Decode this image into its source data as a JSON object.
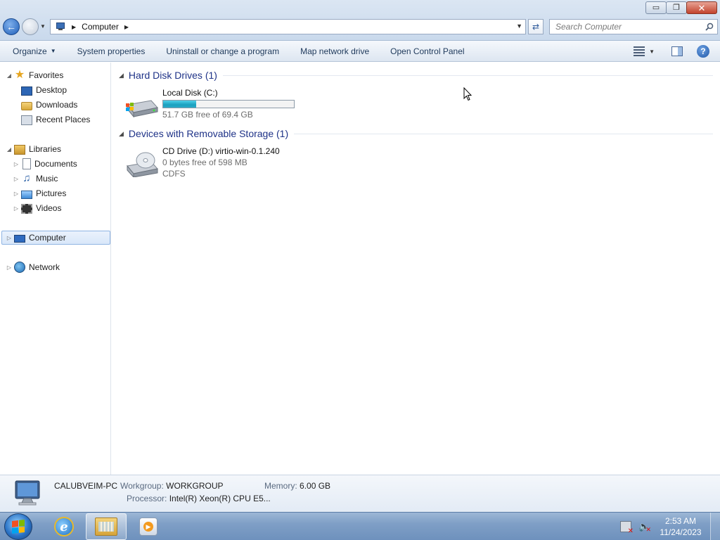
{
  "window": {
    "controls": {
      "minimize": "▭",
      "maximize": "❐",
      "close": "✕"
    }
  },
  "address": {
    "location": "Computer",
    "icon": "computer-icon"
  },
  "search": {
    "placeholder": "Search Computer"
  },
  "commands": {
    "organize": "Organize",
    "system_properties": "System properties",
    "uninstall": "Uninstall or change a program",
    "map_drive": "Map network drive",
    "control_panel": "Open Control Panel",
    "help": "?"
  },
  "nav": {
    "favorites": "Favorites",
    "desktop": "Desktop",
    "downloads": "Downloads",
    "recent_places": "Recent Places",
    "libraries": "Libraries",
    "documents": "Documents",
    "music": "Music",
    "pictures": "Pictures",
    "videos": "Videos",
    "computer": "Computer",
    "network": "Network"
  },
  "groups": {
    "hdd": "Hard Disk Drives (1)",
    "removable": "Devices with Removable Storage (1)"
  },
  "drives": {
    "c": {
      "name": "Local Disk (C:)",
      "free_text": "51.7 GB free of 69.4 GB",
      "used_fraction": 0.255
    },
    "d": {
      "name": "CD Drive (D:) virtio-win-0.1.240",
      "free_text": "0 bytes free of 598 MB",
      "fs": "CDFS"
    }
  },
  "details": {
    "pc_name": "CALUBVEIM-PC",
    "workgroup_label": "Workgroup:",
    "workgroup": "WORKGROUP",
    "memory_label": "Memory:",
    "memory": "6.00 GB",
    "processor_label": "Processor:",
    "processor": "Intel(R) Xeon(R) CPU E5..."
  },
  "taskbar": {
    "ie_letter": "e",
    "time": "2:53 AM",
    "date": "11/24/2023"
  },
  "colors": {
    "group_header": "#1e3287",
    "drive_bar": "#1aa0bf",
    "taskbar": "#7f9fc6"
  }
}
